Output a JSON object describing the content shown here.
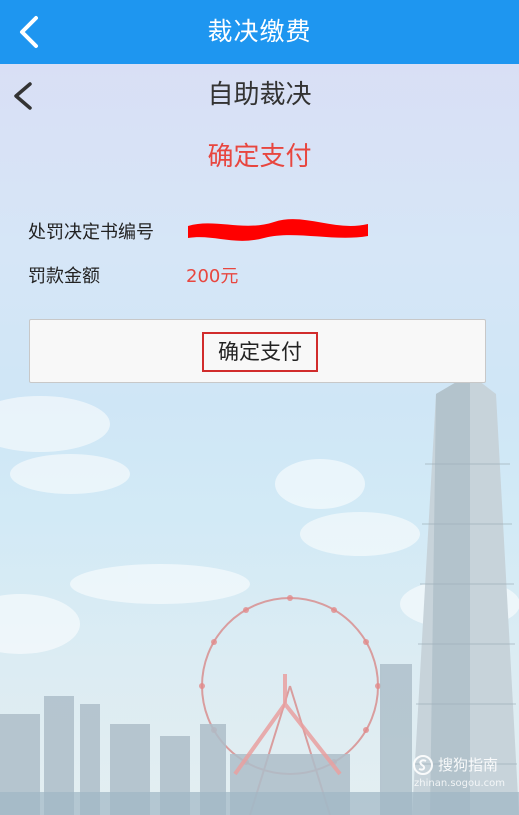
{
  "topbar": {
    "title": "裁决缴费",
    "back_icon": "chevron-left-icon"
  },
  "subheader": {
    "title": "自助裁决",
    "back_icon": "chevron-left-icon"
  },
  "heading": "确定支付",
  "fields": {
    "decision_no_label": "处罚决定书编号",
    "decision_no_value": "",
    "amount_label": "罚款金额",
    "amount_value": "200元"
  },
  "pay_button_label": "确定支付",
  "watermark": {
    "brand": "搜狗指南",
    "url": "zhinan.sogou.com"
  },
  "colors": {
    "header": "#1e96f0",
    "accent_red": "#e8463f",
    "redaction": "#ff0000"
  }
}
